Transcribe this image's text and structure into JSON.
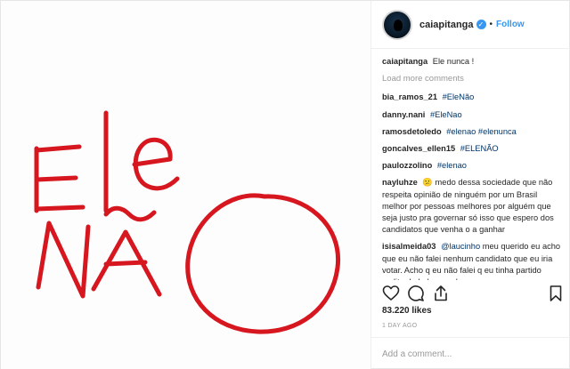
{
  "post": {
    "username": "caiapitanga",
    "follow_label": "Follow",
    "dot": "•",
    "verified_mark": "✓",
    "handwriting_alt": "Ele NÃO"
  },
  "caption": {
    "user": "caiapitanga",
    "text": "Ele nunca !"
  },
  "load_more": "Load more comments",
  "comments": [
    {
      "user": "bia_ramos_21",
      "text": "#EleNão"
    },
    {
      "user": "danny.nani",
      "text": "#EleNao"
    },
    {
      "user": "ramosdetoledo",
      "text": "#elenao #elenunca"
    },
    {
      "user": "goncalves_ellen15",
      "text": "#ELENÃO"
    },
    {
      "user": "paulozzolino",
      "text": "#elenao"
    },
    {
      "user": "nayluhze",
      "text": "😕 medo dessa sociedade que não respeita opinião de ninguém por um Brasil melhor por pessoas melhores por alguém que seja justo pra governar só isso que espero dos candidatos que venha o a ganhar"
    },
    {
      "user": "isisalmeida03",
      "mention": "@laucinho",
      "text": "meu querido eu acho que eu não falei nenhum candidato que eu iria votar. Acho q eu não falei q eu tinha partido sudito do bolso e achar que"
    }
  ],
  "likes": "83.220 likes",
  "time": "1 DAY AGO",
  "add_comment_placeholder": "Add a comment...",
  "icons": [
    "heart-icon",
    "comment-icon",
    "share-icon",
    "bookmark-icon"
  ],
  "colors": {
    "ink": "#d7171f",
    "link": "#3897f0",
    "hashtag": "#003569",
    "muted": "#999999",
    "text": "#262626"
  }
}
